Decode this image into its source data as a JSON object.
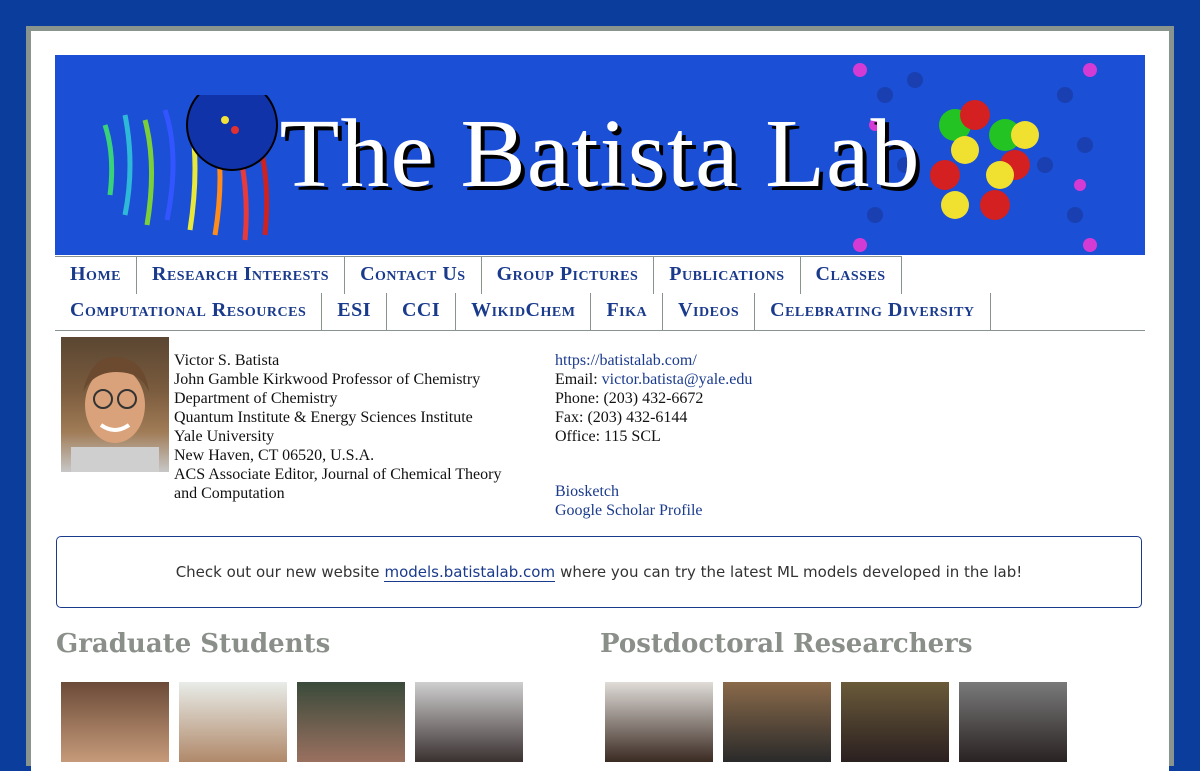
{
  "banner": {
    "title": "The Batista Lab"
  },
  "nav": {
    "row1": [
      "Home",
      "Research Interests",
      "Contact Us",
      "Group Pictures",
      "Publications",
      "Classes"
    ],
    "row2": [
      "Computational Resources",
      "ESI",
      "CCI",
      "WikidChem",
      "Fika",
      "Videos",
      "Celebrating Diversity"
    ]
  },
  "profile": {
    "lines": [
      "Victor S. Batista",
      "John Gamble Kirkwood Professor of Chemistry",
      "Department of Chemistry",
      "Quantum Institute & Energy Sciences Institute",
      "Yale University",
      "New Haven, CT 06520, U.S.A.",
      "ACS Associate Editor, Journal of Chemical Theory",
      "and Computation"
    ],
    "website": "https://batistalab.com/",
    "email_label": "Email:",
    "email": "victor.batista@yale.edu",
    "phone": "Phone: (203) 432-6672",
    "fax": "Fax: (203) 432-6144",
    "office": "Office: 115 SCL",
    "biosketch": "Biosketch",
    "scholar": "Google Scholar Profile"
  },
  "notice": {
    "before": "Check out our new website",
    "link": "models.batistalab.com",
    "after": "where you can try the latest ML models developed in the lab!"
  },
  "sections": {
    "grad": "Graduate Students",
    "postdoc": "Postdoctoral Researchers"
  },
  "colors": {
    "background": "#0a3d9c",
    "banner": "#1b4fd6",
    "link": "#1a3a8c",
    "heading": "#8a8f8a"
  }
}
